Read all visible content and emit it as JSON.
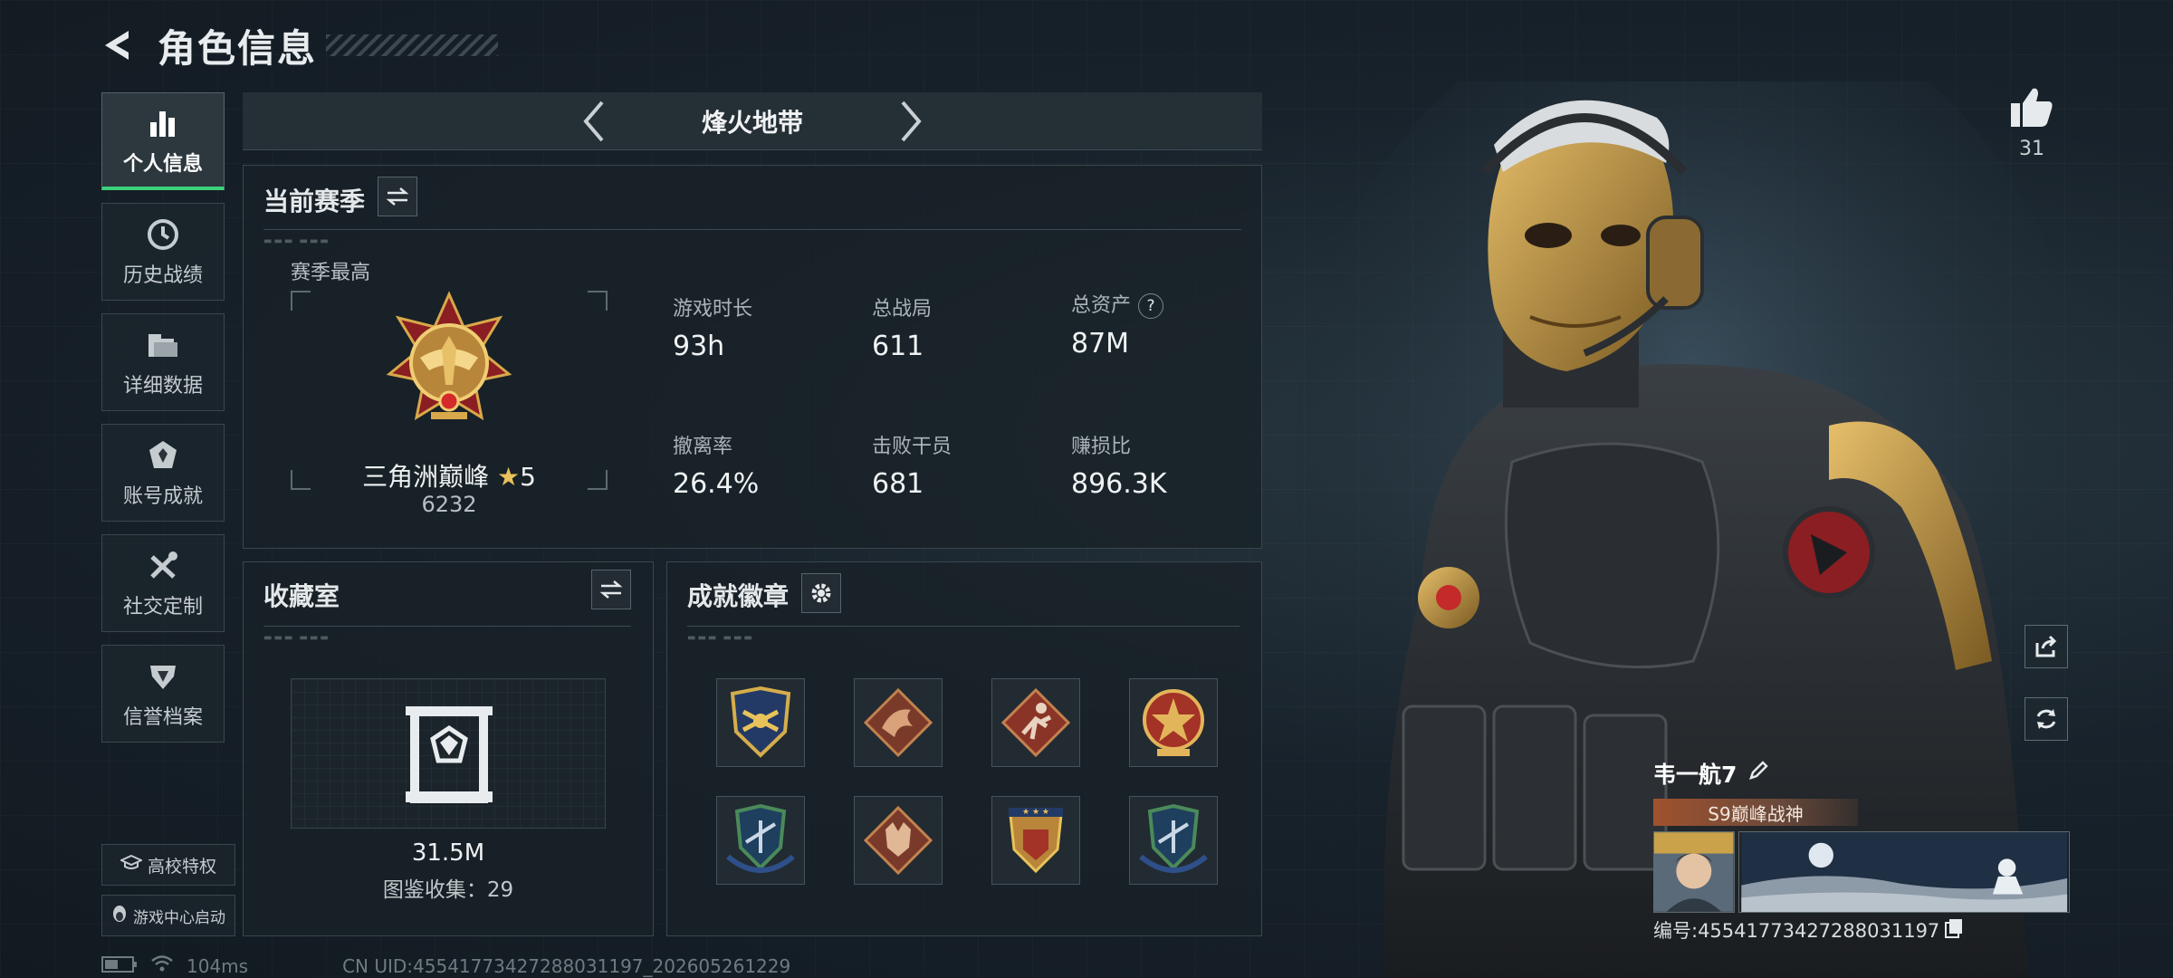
{
  "header": {
    "title": "角色信息"
  },
  "sidebar": {
    "items": [
      {
        "label": "个人信息",
        "icon": "bar-chart-icon",
        "active": true
      },
      {
        "label": "历史战绩",
        "icon": "clock-icon"
      },
      {
        "label": "详细数据",
        "icon": "folder-icon"
      },
      {
        "label": "账号成就",
        "icon": "achievement-icon"
      },
      {
        "label": "社交定制",
        "icon": "tools-icon"
      },
      {
        "label": "信誉档案",
        "icon": "reputation-icon"
      }
    ],
    "campus_label": "高校特权",
    "game_center_label": "游戏中心启动"
  },
  "mode": {
    "name": "烽火地带"
  },
  "season": {
    "title": "当前赛季",
    "best_label": "赛季最高",
    "rank_name": "三角洲巅峰",
    "rank_stars": "5",
    "rank_score": "6232",
    "stats": [
      {
        "label": "游戏时长",
        "value": "93h"
      },
      {
        "label": "总战局",
        "value": "611"
      },
      {
        "label": "总资产",
        "value": "87M",
        "help": "?"
      },
      {
        "label": "撤离率",
        "value": "26.4%"
      },
      {
        "label": "击败干员",
        "value": "681"
      },
      {
        "label": "赚损比",
        "value": "896.3K"
      }
    ]
  },
  "collection": {
    "title": "收藏室",
    "value": "31.5M",
    "count_text": "图鉴收集：29"
  },
  "badges": {
    "title": "成就徽章",
    "items": [
      "shield-badge-gold",
      "dragon-badge",
      "runner-badge",
      "star-medal-badge",
      "wings-shield-badge-blue",
      "wolf-badge",
      "shield-crest-badge",
      "wings-shield-badge-blue-2"
    ]
  },
  "status": {
    "ping": "104ms",
    "uid": "CN UID:4554177342728803119​7_202605261229"
  },
  "player": {
    "likes": "31",
    "name": "韦一航7",
    "title_tag": "S9巅峰战神",
    "id_text": "编号:4554177342728803119​7"
  },
  "colors": {
    "accent_green": "#3ad17a",
    "title_tag": "#a0522d"
  }
}
